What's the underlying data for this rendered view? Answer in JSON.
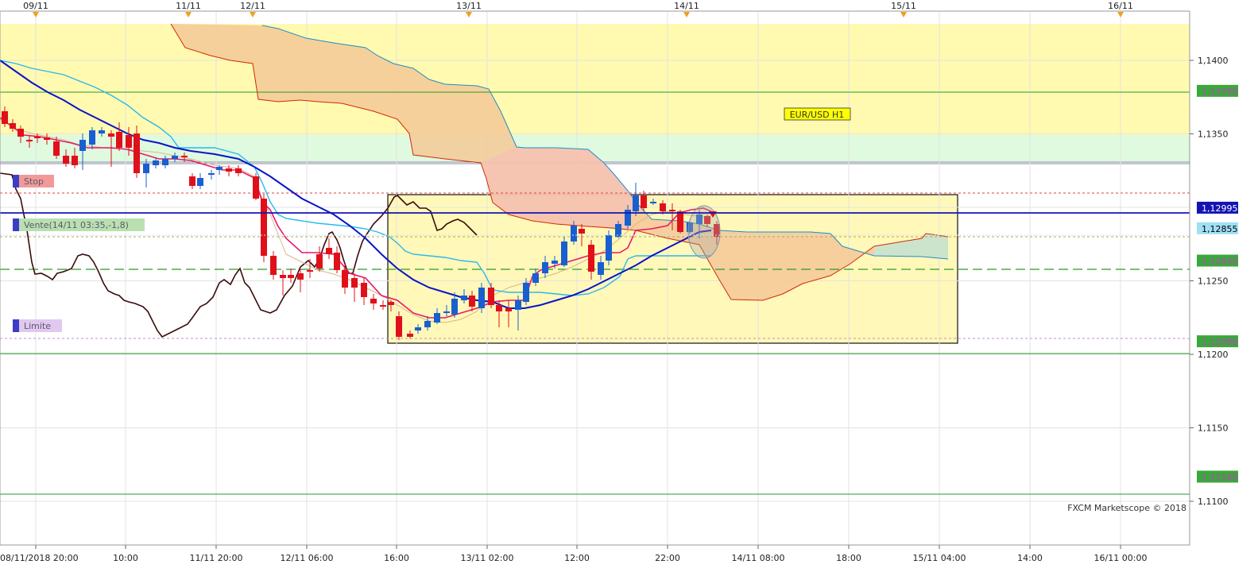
{
  "chart_data": {
    "type": "candlestick",
    "instrument_label": "EUR/USD H1",
    "copyright": "FXCM Marketscope © 2018",
    "x_ticks": [
      "08/11/2018 20:00",
      "10:00",
      "11/11 20:00",
      "12/11 06:00",
      "16:00",
      "13/11 02:00",
      "12:00",
      "22:00",
      "14/11 08:00",
      "18:00",
      "15/11 04:00",
      "14:00",
      "16/11 00:00"
    ],
    "top_dates": [
      "09/11",
      "11/11",
      "12/11",
      "13/11",
      "14/11",
      "15/11",
      "16/11"
    ],
    "y_ticks": [
      "1,1400",
      "1,1350",
      "1,1250",
      "1,1200",
      "1,1150",
      "1,1100"
    ],
    "price_labels": [
      {
        "text": "1,13790",
        "value": 1.1379,
        "bg": "#3aa83a",
        "fg": "#c040c0"
      },
      {
        "text": "1,12995",
        "value": 1.12995,
        "bg": "#1414b4",
        "fg": "#ffffff"
      },
      {
        "text": "1,12855",
        "value": 1.12855,
        "bg": "#9fe0f5",
        "fg": "#000000"
      },
      {
        "text": "1,12635",
        "value": 1.12635,
        "bg": "#3aa83a",
        "fg": "#c040c0"
      },
      {
        "text": "1,12086",
        "value": 1.12086,
        "bg": "#3aa83a",
        "fg": "#c040c0"
      },
      {
        "text": "1,11165",
        "value": 1.11165,
        "bg": "#3aa83a",
        "fg": "#c040c0"
      }
    ],
    "order_tags": [
      {
        "text": "Stop",
        "value": 1.131,
        "bg": "#f29a9a",
        "marker": "#3c3cc8"
      },
      {
        "text": "Vente(14/11 03:35,-1,8)",
        "value": 1.12875,
        "bg": "#b8e0b0",
        "marker": "#3c3cc8"
      },
      {
        "text": "Limite",
        "value": 1.1217,
        "bg": "#e0c8f0",
        "marker": "#3c3cc8"
      }
    ],
    "y_range": [
      1.1082,
      1.143
    ],
    "colors": {
      "up": "#1a5fd0",
      "down": "#e0101a",
      "kijun": "#0a14c8",
      "tenkan": "#e8186e",
      "chikou": "#3a0c0c",
      "kumo_line": "#2aa8e8",
      "cloud_bear": "#f5c896",
      "cloud_bull": "#c8e6d2",
      "bg_zone": "#fffaaf",
      "green_zone": "#dffadf"
    }
  }
}
